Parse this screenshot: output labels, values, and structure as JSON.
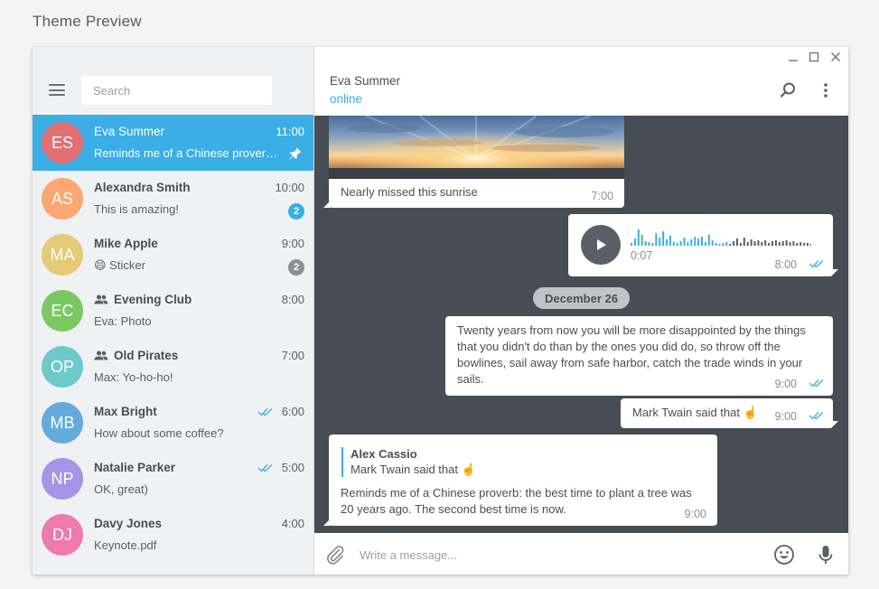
{
  "page": {
    "title": "Theme Preview"
  },
  "sidebar": {
    "search_placeholder": "Search",
    "chats": [
      {
        "initials": "ES",
        "name": "Eva Summer",
        "time": "11:00",
        "preview": "Reminds me of a Chinese proverb: the best time to plant a tree",
        "color": "#e17076",
        "active": true,
        "pinned": true
      },
      {
        "initials": "AS",
        "name": "Alexandra Smith",
        "time": "10:00",
        "preview": "This is amazing!",
        "color": "#faa774",
        "badge": "2",
        "badge_color": "#3aaee5"
      },
      {
        "initials": "MA",
        "name": "Mike Apple",
        "time": "9:00",
        "preview": "😄 Sticker",
        "color": "#e5ca77",
        "badge": "2",
        "badge_color": "#8b8e93"
      },
      {
        "initials": "EC",
        "name": "Evening Club",
        "time": "8:00",
        "preview": "Eva: Photo",
        "color": "#7bc862",
        "group": true
      },
      {
        "initials": "OP",
        "name": "Old Pirates",
        "time": "7:00",
        "preview": "Max: Yo-ho-ho!",
        "color": "#6ec9cb",
        "group": true
      },
      {
        "initials": "MB",
        "name": "Max Bright",
        "time": "6:00",
        "preview": "How about some coffee?",
        "color": "#65aadd",
        "read": true
      },
      {
        "initials": "NP",
        "name": "Natalie Parker",
        "time": "5:00",
        "preview": "OK, great)",
        "color": "#a695e7",
        "read": true
      },
      {
        "initials": "DJ",
        "name": "Davy Jones",
        "time": "4:00",
        "preview": "Keynote.pdf",
        "color": "#ee7aae"
      }
    ]
  },
  "chat": {
    "peer_name": "Eva Summer",
    "peer_status": "online",
    "messages": {
      "photo_caption": "Nearly missed this sunrise",
      "photo_time": "7:00",
      "voice_duration": "0:07",
      "voice_time": "8:00",
      "date_separator": "December 26",
      "quote_text": "Twenty years from now you will be more disappointed by the things that you didn't do than by the ones you did do, so throw off the bowlines, sail away from safe harbor, catch the trade winds in your sails.",
      "quote_time": "9:00",
      "twain_text": "Mark Twain said that ☝️",
      "twain_time": "9:00",
      "reply_author": "Alex Cassio",
      "reply_quote": "Mark Twain said that ☝️",
      "reply_text": "Reminds me of a Chinese proverb: the best time to plant a tree was 20 years ago. The second best time is now.",
      "reply_time": "9:00"
    },
    "composer_placeholder": "Write a message..."
  },
  "colors": {
    "accent": "#3aaee5",
    "chat_bg": "#474d54",
    "sidebar_bg": "#f0f1f3"
  }
}
